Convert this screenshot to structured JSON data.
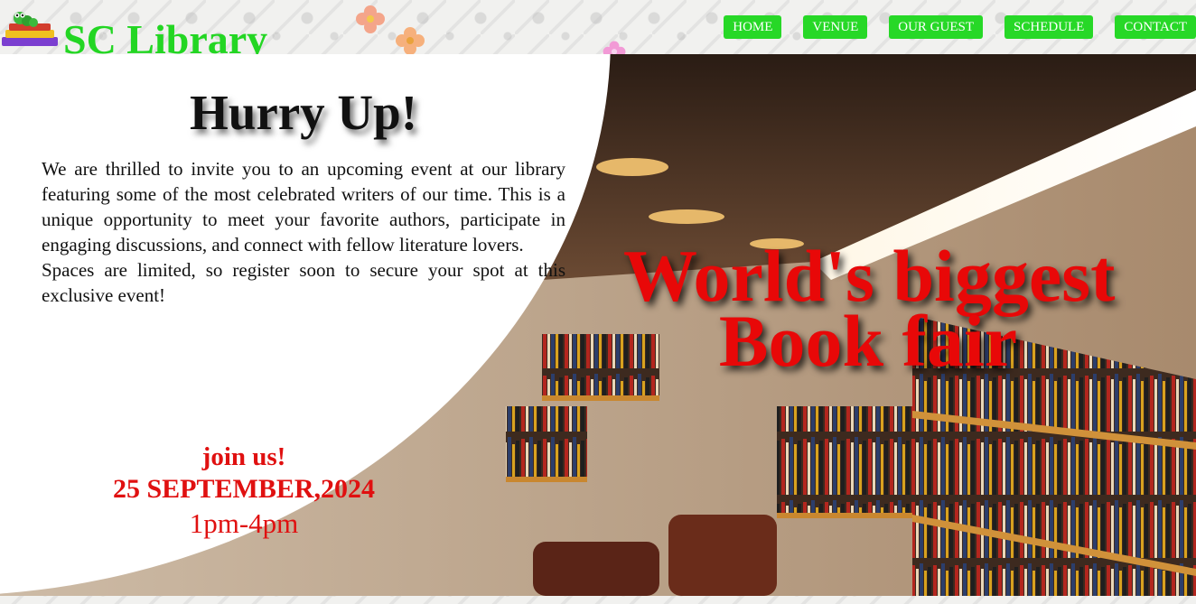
{
  "header": {
    "brand_name": "SC Library",
    "logo_icon": "bookworm-on-books-icon",
    "nav": [
      {
        "label": "HOME"
      },
      {
        "label": "VENUE"
      },
      {
        "label": "OUR GUEST"
      },
      {
        "label": "SCHEDULE"
      },
      {
        "label": "CONTACT"
      }
    ]
  },
  "hero": {
    "heading": "Hurry Up!",
    "paragraphs": [
      "We are thrilled to invite you to an upcoming event at our library featuring some of the most celebrated writers of our time. This is a unique opportunity to meet your favorite authors, participate in engaging discussions, and connect with fellow literature lovers.",
      "Spaces are limited, so register soon to secure your spot at this exclusive event!"
    ],
    "join_text": "join us!",
    "date": "25 SEPTEMBER,2024",
    "time": "1pm-4pm",
    "promo_line1": "World's biggest",
    "promo_line2": "Book fair"
  },
  "colors": {
    "brand_green": "#23d623",
    "nav_button": "#27d827",
    "accent_red": "#e01010"
  }
}
